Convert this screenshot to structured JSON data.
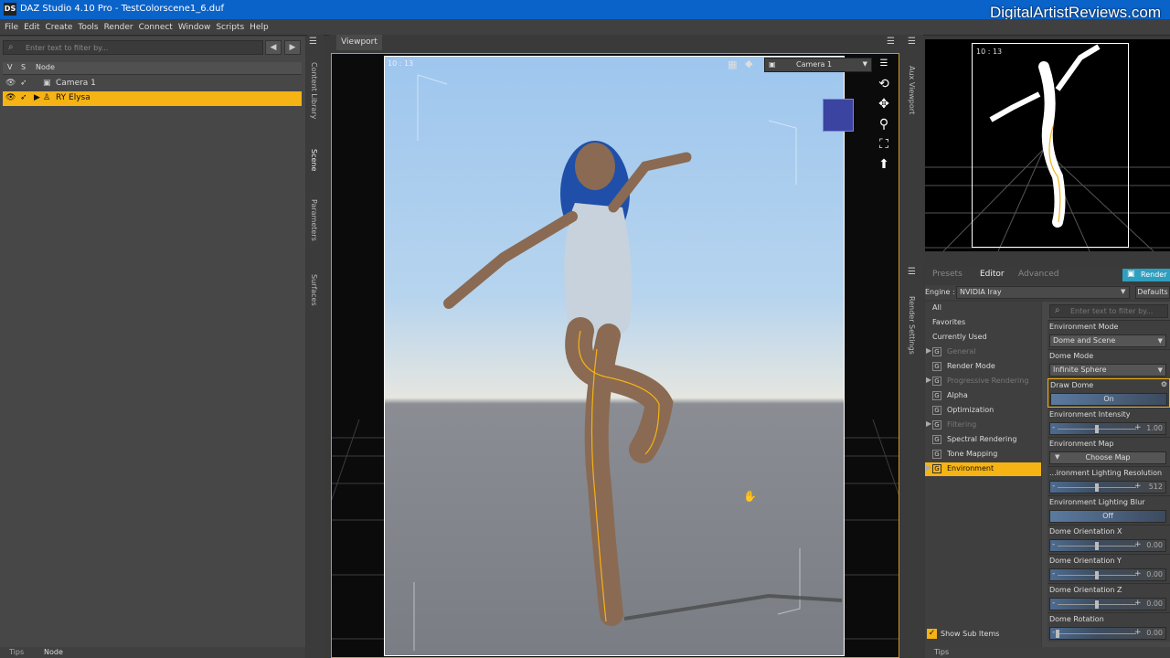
{
  "window": {
    "title": "DAZ Studio 4.10 Pro - TestColorscene1_6.duf",
    "app_icon": "DS",
    "watermark": "DigitalArtistReviews.com"
  },
  "menu": [
    "File",
    "Edit",
    "Create",
    "Tools",
    "Render",
    "Connect",
    "Window",
    "Scripts",
    "Help"
  ],
  "scene_pane": {
    "filter_placeholder": "Enter text to filter by...",
    "columns": [
      "V",
      "S",
      "Node"
    ],
    "nodes": [
      {
        "label": "Camera 1",
        "selected": false
      },
      {
        "label": "RY Elysa",
        "selected": true
      }
    ],
    "side_tabs": [
      "Content Library",
      "Scene",
      "Parameters",
      "Surfaces"
    ],
    "bottom_tabs": [
      "Tips",
      "Node"
    ]
  },
  "viewport": {
    "tab": "Viewport",
    "camera": "Camera 1",
    "aspect_label": "10 : 13"
  },
  "aux_viewport": {
    "tab": "Aux Viewport",
    "aspect_label": "10 : 13"
  },
  "render_settings": {
    "side_tab": "Render Settings",
    "tabs": [
      "Presets",
      "Editor",
      "Advanced"
    ],
    "active_tab": "Editor",
    "render_button": "Render",
    "engine_label": "Engine :",
    "engine": "NVIDIA Iray",
    "defaults_button": "Defaults",
    "filter_placeholder": "Enter text to filter by...",
    "categories": [
      {
        "label": "All",
        "type": "top"
      },
      {
        "label": "Favorites",
        "type": "top"
      },
      {
        "label": "Currently Used",
        "type": "top"
      },
      {
        "label": "General",
        "type": "group",
        "arrow": true,
        "dim": true
      },
      {
        "label": "Render Mode",
        "type": "group"
      },
      {
        "label": "Progressive Rendering",
        "type": "group",
        "arrow": true,
        "dim": true
      },
      {
        "label": "Alpha",
        "type": "group"
      },
      {
        "label": "Optimization",
        "type": "group"
      },
      {
        "label": "Filtering",
        "type": "group",
        "arrow": true,
        "dim": true
      },
      {
        "label": "Spectral Rendering",
        "type": "group"
      },
      {
        "label": "Tone Mapping",
        "type": "group"
      },
      {
        "label": "Environment",
        "type": "group",
        "arrow": true,
        "selected": true
      }
    ],
    "properties": [
      {
        "label": "Environment Mode",
        "kind": "dropdown",
        "value": "Dome and Scene"
      },
      {
        "label": "Dome Mode",
        "kind": "dropdown",
        "value": "Infinite Sphere"
      },
      {
        "label": "Draw Dome",
        "kind": "toggle",
        "value": "On",
        "highlight": true
      },
      {
        "label": "Environment Intensity",
        "kind": "slider",
        "value": "1.00",
        "level": 0.5
      },
      {
        "label": "Environment Map",
        "kind": "map",
        "value": "Choose Map"
      },
      {
        "label": "...ironment Lighting Resolution",
        "kind": "slider",
        "value": "512",
        "level": 0.5
      },
      {
        "label": "Environment Lighting Blur",
        "kind": "toggle",
        "value": "Off"
      },
      {
        "label": "Dome Orientation X",
        "kind": "slider",
        "value": "0.00",
        "level": 0.5
      },
      {
        "label": "Dome Orientation Y",
        "kind": "slider",
        "value": "0.00",
        "level": 0.5
      },
      {
        "label": "Dome Orientation Z",
        "kind": "slider",
        "value": "0.00",
        "level": 0.5
      },
      {
        "label": "Dome Rotation",
        "kind": "slider",
        "value": "0.00",
        "level": 0.0
      }
    ],
    "show_sub_items": "Show Sub Items",
    "tips_tab": "Tips"
  }
}
